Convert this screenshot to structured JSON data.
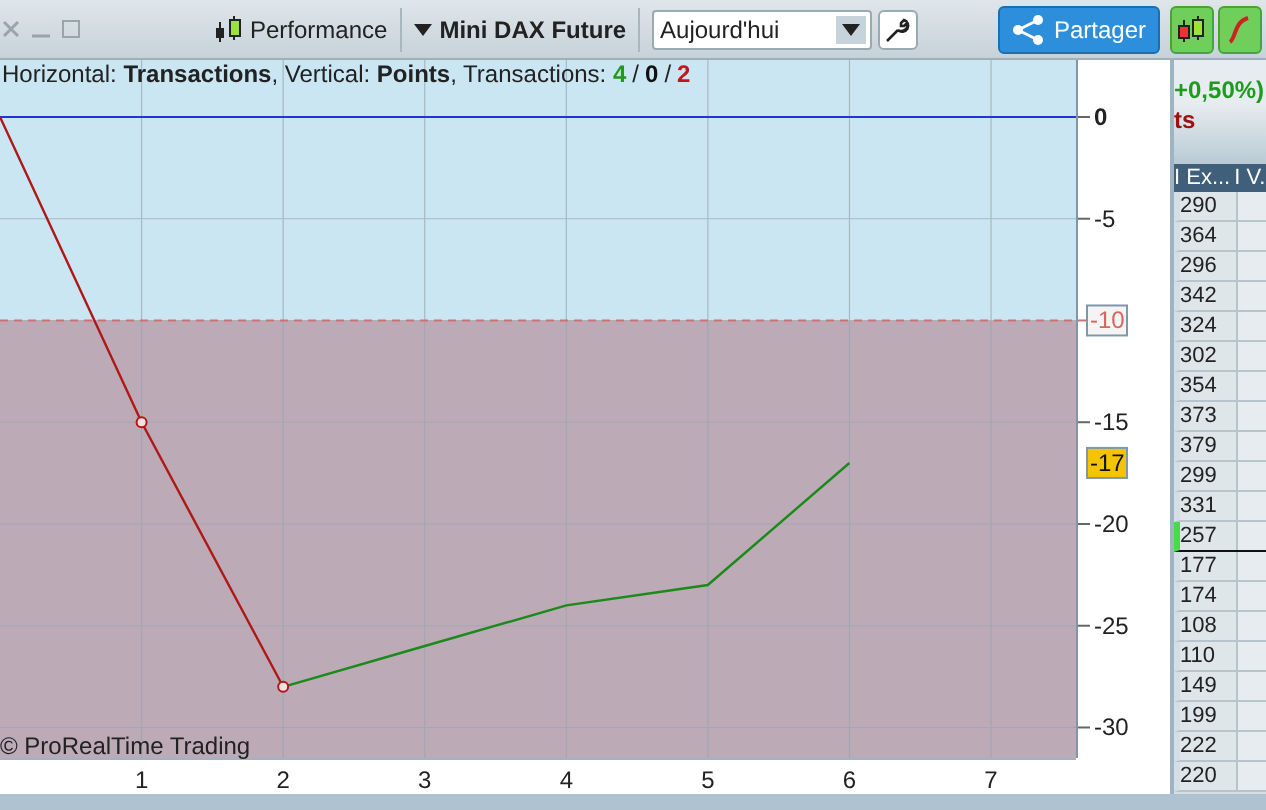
{
  "toolbar": {
    "performance_label": "Performance",
    "instrument": "Mini DAX Future",
    "period": {
      "value": "Aujourd'hui"
    },
    "share_button": "Partager"
  },
  "chart": {
    "legend": {
      "text": "Horizontal: **Transactions**, Vertical: **Points**, Transactions: ",
      "counts": [
        {
          "value": "4",
          "kind": "win"
        },
        {
          "value": "/",
          "kind": "separator"
        },
        {
          "value": "0",
          "kind": "even"
        },
        {
          "value": "/",
          "kind": "separator"
        },
        {
          "value": "2",
          "kind": "loss"
        }
      ]
    },
    "watermark": "© ProRealTime Trading",
    "current_label": "-17",
    "chart_data": {
      "type": "line",
      "x": [
        0,
        1,
        2,
        3,
        4,
        5,
        6
      ],
      "series": [
        {
          "color": "#b01818",
          "values": [
            0,
            -15,
            -28,
            null,
            null,
            null,
            null
          ]
        },
        {
          "color": "#1a8a1a",
          "values": [
            null,
            null,
            -28,
            -26,
            -24,
            -23,
            -17
          ]
        }
      ],
      "xlim": [
        0,
        7.6
      ],
      "ylim": [
        -31.5,
        2.8
      ],
      "xticks": [
        {
          "value": 1,
          "label": "1"
        },
        {
          "value": 2,
          "label": "2"
        },
        {
          "value": 3,
          "label": "3"
        },
        {
          "value": 4,
          "label": "4"
        },
        {
          "value": 5,
          "label": "5"
        },
        {
          "value": 6,
          "label": "6"
        },
        {
          "value": 7,
          "label": "7"
        }
      ],
      "yticks": [
        {
          "value": 0,
          "label": "0"
        },
        {
          "value": -5,
          "label": "-5"
        },
        {
          "value": -10,
          "label": "-10"
        },
        {
          "value": -15,
          "label": "-15"
        },
        {
          "value": -20,
          "label": "-20"
        },
        {
          "value": -25,
          "label": "-25"
        },
        {
          "value": -30,
          "label": "-30"
        }
      ],
      "grid": true,
      "bands": [
        {
          "axis": "y",
          "from": -10,
          "to": 2.8,
          "color": "#c9e6f2"
        },
        {
          "axis": "y",
          "from": -31.5,
          "to": -10,
          "color": "#bcaab6"
        }
      ],
      "ref_lines": [
        {
          "axis": "y",
          "value": 0,
          "color": "#2233dd"
        },
        {
          "axis": "y",
          "value": -10,
          "color": "#d07070"
        }
      ]
    }
  },
  "side_panel": {
    "change": "+0,50%)",
    "label": "ts",
    "columns": [
      "I Ex...",
      "I V."
    ],
    "rows": [
      {
        "value": "290",
        "selected": false
      },
      {
        "value": "364",
        "selected": false
      },
      {
        "value": "296",
        "selected": false
      },
      {
        "value": "342",
        "selected": false
      },
      {
        "value": "324",
        "selected": false
      },
      {
        "value": "302",
        "selected": false
      },
      {
        "value": "354",
        "selected": false
      },
      {
        "value": "373",
        "selected": false
      },
      {
        "value": "379",
        "selected": false
      },
      {
        "value": "299",
        "selected": false
      },
      {
        "value": "331",
        "selected": false
      },
      {
        "value": "257",
        "selected": true
      },
      {
        "value": "177",
        "selected": false
      },
      {
        "value": "174",
        "selected": false
      },
      {
        "value": "108",
        "selected": false
      },
      {
        "value": "110",
        "selected": false
      },
      {
        "value": "149",
        "selected": false
      },
      {
        "value": "199",
        "selected": false
      },
      {
        "value": "222",
        "selected": false
      },
      {
        "value": "220",
        "selected": false
      }
    ]
  }
}
